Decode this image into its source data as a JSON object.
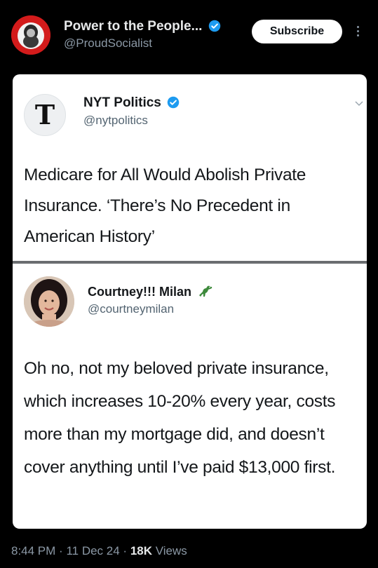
{
  "post": {
    "author_name": "Power to the People...",
    "author_handle": "@ProudSocialist",
    "subscribe_label": "Subscribe",
    "time": "8:44 PM",
    "date": "11 Dec 24",
    "separator": "·",
    "views_count": "18K",
    "views_label": "Views"
  },
  "screenshot": {
    "nyt": {
      "name": "NYT Politics",
      "handle": "@nytpolitics",
      "avatar_letter": "T",
      "text": "Medicare for All Would Abolish Private Insurance. ‘There’s No Precedent in American History’"
    },
    "reply": {
      "name": "Courtney!!! Milan",
      "handle": "@courtneymilan",
      "text": "Oh no, not my beloved private insurance, which increases 10-20% every year, costs more than my mortgage did, and doesn’t cover anything until I’ve paid $13,000 first."
    }
  },
  "colors": {
    "background": "#000000",
    "verified_blue": "#1d9bf0",
    "avatar_red": "#d31b1b",
    "muted_text": "#8b98a5"
  },
  "icons": [
    "verified-badge-icon",
    "more-options-icon",
    "chevron-down-icon",
    "dinosaur-emoji-icon"
  ]
}
